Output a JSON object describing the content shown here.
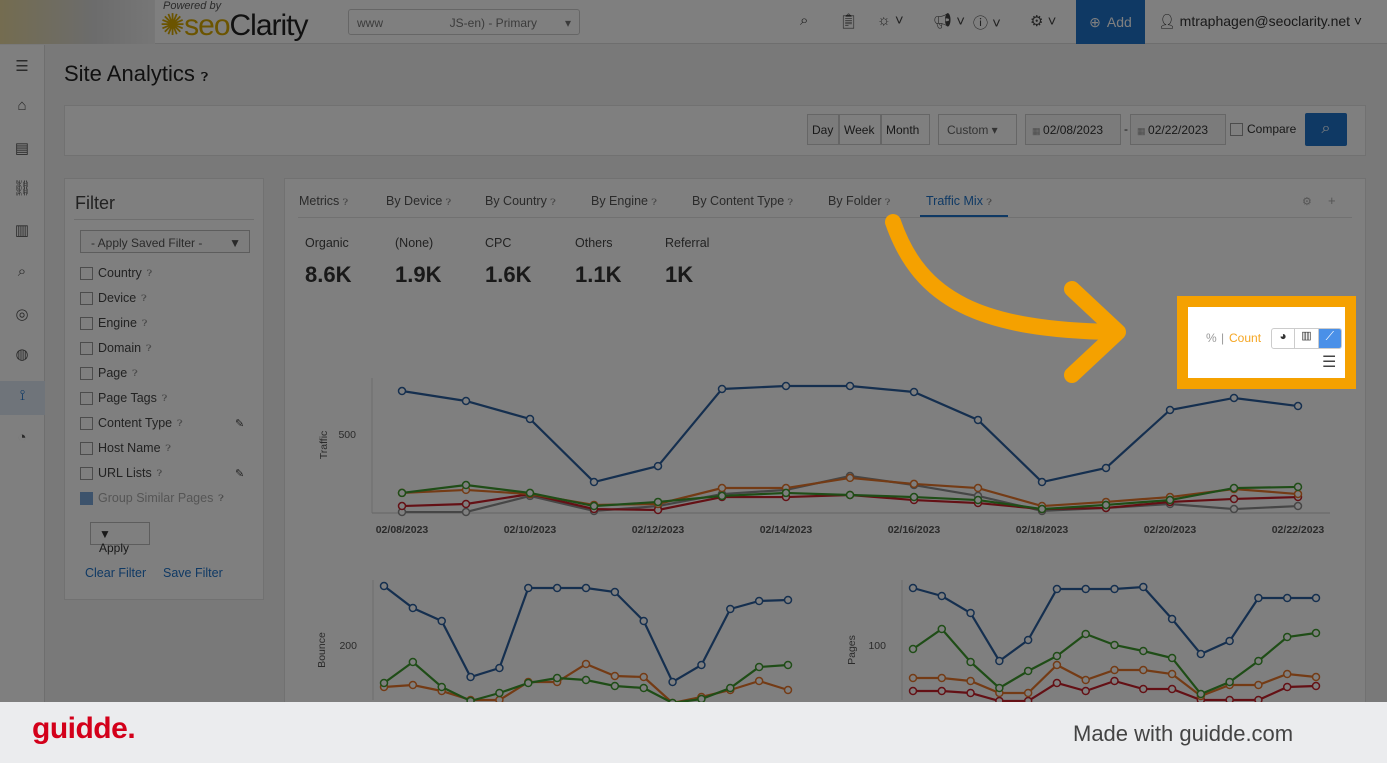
{
  "topbar": {
    "powered_by": "Powered by",
    "brand_seo": "seo",
    "brand_clarity": "Clarity",
    "site_select": "www                    JS-en) - Primary",
    "add_label": "Add",
    "user": "mtraphagen@seoclarity.net"
  },
  "page": {
    "title": "Site Analytics"
  },
  "datebar": {
    "day": "Day",
    "week": "Week",
    "month": "Month",
    "range": "Custom",
    "start": "02/08/2023",
    "sep": "-",
    "end": "02/22/2023",
    "compare": "Compare"
  },
  "filter": {
    "title": "Filter",
    "saved": "- Apply Saved Filter -",
    "items": [
      "Country",
      "Device",
      "Engine",
      "Domain",
      "Page",
      "Page Tags",
      "Content Type",
      "Host Name",
      "URL Lists",
      "Group Similar Pages"
    ],
    "apply": "Apply",
    "clear": "Clear Filter",
    "save": "Save Filter"
  },
  "tabs": [
    "Metrics",
    "By Device",
    "By Country",
    "By Engine",
    "By Content Type",
    "By Folder",
    "Traffic Mix"
  ],
  "active_tab": "Traffic Mix",
  "kpis": [
    {
      "label": "Organic",
      "value": "8.6K"
    },
    {
      "label": "(None)",
      "value": "1.9K"
    },
    {
      "label": "CPC",
      "value": "1.6K"
    },
    {
      "label": "Others",
      "value": "1.1K"
    },
    {
      "label": "Referral",
      "value": "1K"
    }
  ],
  "toggle": {
    "percent": "%",
    "sep": "|",
    "count": "Count",
    "active_view": "line-chart-icon"
  },
  "colors": {
    "accent": "#1f73c9",
    "highlight": "#f5a100",
    "count": "#f5a623",
    "guidde": "#d3001a"
  },
  "chart_data": [
    {
      "type": "line",
      "ylabel": "Traffic",
      "yticks": [
        500
      ],
      "x": [
        "02/08/2023",
        "02/09/2023",
        "02/10/2023",
        "02/11/2023",
        "02/12/2023",
        "02/13/2023",
        "02/14/2023",
        "02/15/2023",
        "02/16/2023",
        "02/17/2023",
        "02/18/2023",
        "02/19/2023",
        "02/20/2023",
        "02/21/2023",
        "02/22/2023"
      ],
      "xticks": [
        "02/08/2023",
        "02/10/2023",
        "02/12/2023",
        "02/14/2023",
        "02/16/2023",
        "02/18/2023",
        "02/20/2023",
        "02/22/2023"
      ],
      "series": [
        {
          "color": "#2b5f9e",
          "values": [
            772,
            709,
            595,
            196,
            297,
            785,
            804,
            804,
            766,
            589,
            196,
            285,
            652,
            728,
            677
          ]
        },
        {
          "color": "#3f9a2e",
          "values": [
            127,
            177,
            127,
            44,
            70,
            108,
            127,
            114,
            101,
            82,
            25,
            51,
            82,
            158,
            165
          ]
        },
        {
          "color": "#e8772a",
          "values": [
            127,
            146,
            120,
            51,
            57,
            158,
            158,
            222,
            184,
            158,
            44,
            70,
            101,
            152,
            120
          ]
        },
        {
          "color": "#c9202a",
          "values": [
            44,
            57,
            120,
            25,
            19,
            101,
            101,
            114,
            82,
            63,
            25,
            32,
            70,
            89,
            101
          ]
        },
        {
          "color": "#8c8c8c",
          "values": [
            6,
            6,
            108,
            13,
            44,
            120,
            146,
            234,
            177,
            108,
            13,
            32,
            57,
            25,
            44
          ]
        }
      ]
    },
    {
      "type": "line",
      "ylabel": "Bounce",
      "yticks": [
        200
      ],
      "series": [
        {
          "color": "#2b5f9e",
          "values": [
            318,
            274,
            248,
            136,
            154,
            314,
            314,
            314,
            306,
            248,
            126,
            160,
            272,
            288,
            290
          ]
        },
        {
          "color": "#3f9a2e",
          "values": [
            124,
            166,
            116,
            88,
            104,
            124,
            134,
            130,
            118,
            114,
            84,
            92,
            114,
            156,
            160
          ]
        },
        {
          "color": "#e8772a",
          "values": [
            116,
            120,
            108,
            90,
            90,
            126,
            126,
            162,
            138,
            136,
            84,
            96,
            110,
            128,
            110
          ]
        }
      ]
    },
    {
      "type": "line",
      "ylabel": "Pages",
      "yticks": [
        100
      ],
      "series": [
        {
          "color": "#2b5f9e",
          "values": [
            157,
            149,
            132,
            84,
            105,
            156,
            156,
            156,
            158,
            126,
            91,
            104,
            147,
            147,
            147
          ]
        },
        {
          "color": "#3f9a2e",
          "values": [
            96,
            116,
            83,
            57,
            74,
            89,
            111,
            100,
            94,
            87,
            51,
            63,
            84,
            108,
            112
          ]
        },
        {
          "color": "#e8772a",
          "values": [
            67,
            67,
            64,
            52,
            52,
            80,
            65,
            75,
            75,
            71,
            49,
            60,
            60,
            71,
            68
          ]
        },
        {
          "color": "#c9202a",
          "values": [
            54,
            54,
            52,
            44,
            44,
            62,
            54,
            64,
            56,
            56,
            45,
            45,
            45,
            58,
            59
          ]
        }
      ]
    }
  ],
  "footer": {
    "brand": "guidde.",
    "made_with": "Made with guidde.com"
  }
}
